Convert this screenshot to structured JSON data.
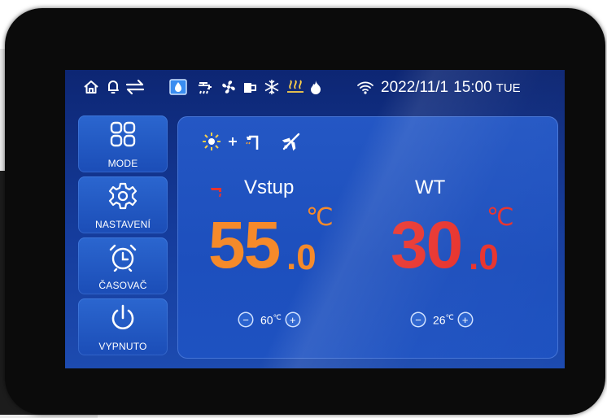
{
  "status_bar": {
    "icons": [
      "home-icon",
      "bell-icon",
      "transfer-arrows-icon",
      "water-mode-icon",
      "water-tap-icon",
      "fan-icon",
      "pump-icon",
      "snowflake-icon",
      "floor-heating-icon",
      "flame-icon",
      "wifi-icon"
    ],
    "date": "2022/11/1",
    "time": "15:00",
    "day": "TUE"
  },
  "sidebar": {
    "items": [
      {
        "label": "MODE",
        "icon": "grid-icon"
      },
      {
        "label": "NASTAVENÍ",
        "icon": "gear-icon"
      },
      {
        "label": "ČASOVAČ",
        "icon": "alarm-clock-icon"
      },
      {
        "label": "VYPNUTO",
        "icon": "power-icon"
      }
    ]
  },
  "panel": {
    "mode_icons": [
      "sun-icon",
      "plus-icon",
      "shower-icon",
      "airplane-icon"
    ],
    "zones": [
      {
        "label": "Vstup",
        "icon": "water-tap-icon",
        "temp_int": "55",
        "temp_dec": ".0",
        "unit": "℃",
        "setpoint": "60",
        "setpoint_unit": "℃",
        "minus": "−",
        "plus": "+"
      },
      {
        "label": "WT",
        "temp_int": "30",
        "temp_dec": ".0",
        "unit": "℃",
        "setpoint": "26",
        "setpoint_unit": "℃",
        "minus": "−",
        "plus": "+"
      }
    ]
  },
  "colors": {
    "orange": "#f58a2a",
    "red": "#e8332d",
    "screen_blue": "#1d4fbd"
  }
}
